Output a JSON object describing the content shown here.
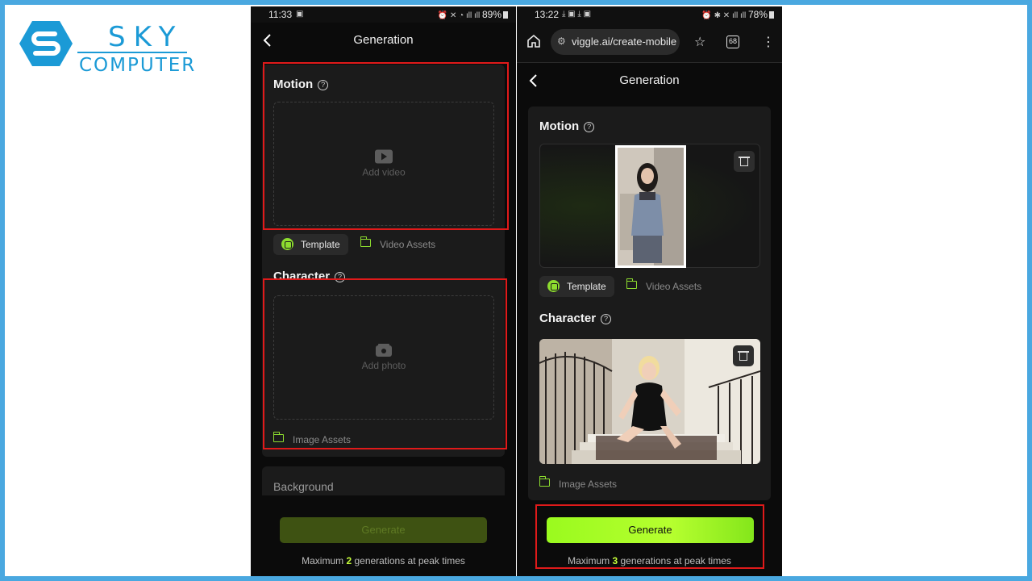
{
  "brand": {
    "top": "SKY",
    "bottom": "COMPUTER"
  },
  "phone1": {
    "status": {
      "time": "11:33",
      "battery": "89%"
    },
    "header_title": "Generation",
    "motion": {
      "title": "Motion",
      "drop_label": "Add video"
    },
    "tabs": [
      {
        "label": "Template"
      },
      {
        "label": "Video Assets"
      }
    ],
    "character": {
      "title": "Character",
      "drop_label": "Add photo"
    },
    "image_assets": "Image Assets",
    "background_label": "Background",
    "generate_label": "Generate",
    "peak": {
      "prefix": "Maximum ",
      "count": "2",
      "suffix": " generations at peak times"
    }
  },
  "phone2": {
    "status": {
      "time": "13:22",
      "battery": "78%"
    },
    "url": "viggle.ai/create-mobile",
    "tab_count": "68",
    "header_title": "Generation",
    "motion": {
      "title": "Motion"
    },
    "tabs": [
      {
        "label": "Template"
      },
      {
        "label": "Video Assets"
      }
    ],
    "character": {
      "title": "Character"
    },
    "image_assets": "Image Assets",
    "generate_label": "Generate",
    "peak": {
      "prefix": "Maximum ",
      "count": "3",
      "suffix": " generations at peak times"
    }
  },
  "colors": {
    "accent": "#8ddc2f",
    "highlight": "#e01a1a",
    "brand": "#1b9ad6"
  }
}
